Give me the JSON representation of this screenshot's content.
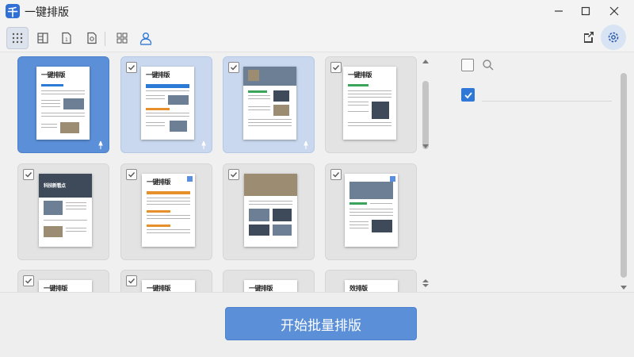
{
  "window": {
    "title": "一键排版",
    "logo_char": "千"
  },
  "toolbar": {
    "tools": [
      "grid-view-icon",
      "layout-columns-icon",
      "page-number-icon",
      "page-settings-icon",
      "blocks-layout-icon",
      "user-icon"
    ],
    "active_index": 0
  },
  "thumbnails": [
    {
      "title": "一键排版",
      "state": "selected",
      "checked": false
    },
    {
      "title": "一键排版",
      "state": "highlighted",
      "checked": true
    },
    {
      "title": "",
      "state": "highlighted",
      "checked": true
    },
    {
      "title": "一键排版",
      "state": "normal",
      "checked": true
    },
    {
      "title": "科技新看点",
      "state": "normal",
      "checked": true
    },
    {
      "title": "一键排版",
      "state": "normal",
      "checked": true
    },
    {
      "title": "",
      "state": "normal",
      "checked": true
    },
    {
      "title": "",
      "state": "normal",
      "checked": true
    },
    {
      "title": "一键排版",
      "state": "normal",
      "checked": true
    },
    {
      "title": "一键排版",
      "state": "normal",
      "checked": true
    },
    {
      "title": "一键排版",
      "state": "normal",
      "checked": false
    },
    {
      "title": "效排版",
      "state": "normal",
      "checked": false
    }
  ],
  "colors": {
    "accent": "#5b8fd8",
    "checkbox_checked": "#2f78d8",
    "selected_card": "#5b8fd8",
    "highlight_card": "#c9d8ee"
  },
  "right_panel": {
    "option1_checked": false,
    "option2_checked": true
  },
  "actions": {
    "start_label": "开始批量排版"
  }
}
